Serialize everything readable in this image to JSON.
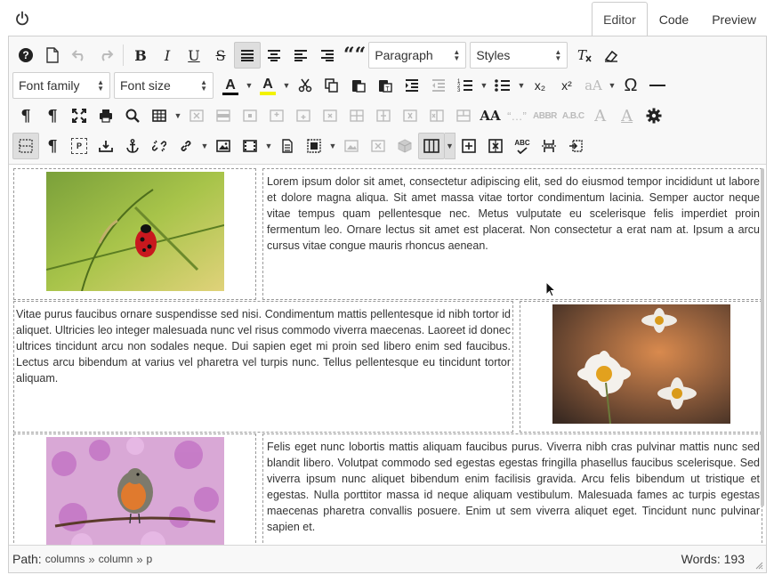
{
  "tabs": [
    {
      "label": "Editor",
      "active": true
    },
    {
      "label": "Code",
      "active": false
    },
    {
      "label": "Preview",
      "active": false
    }
  ],
  "toolbar": {
    "block_format": "Paragraph",
    "styles": "Styles",
    "font_family": "Font family",
    "font_size": "Font size",
    "bold": "B",
    "italic": "I",
    "underline": "U",
    "strikethrough": "S",
    "blockquote": "““",
    "subscript": "x₂",
    "superscript": "x²",
    "change_case": "aA",
    "omega": "Ω",
    "text_color_letter": "A",
    "bg_color_letter": "A",
    "text_color": "#000000",
    "bg_color": "#f2f200",
    "pilcrow_ltr": "¶",
    "pilcrow_rtl": "¶",
    "pilcrow": "¶",
    "p_label": "P",
    "aa_spell": "AA",
    "quote_dots": "“…”",
    "abbr": "ABBR",
    "abc": "A.B.C",
    "abc_check": "ABC",
    "font_a1": "A",
    "font_a2": "A"
  },
  "content": {
    "row1_text": "Lorem ipsum dolor sit amet, consectetur adipiscing elit, sed do eiusmod tempor incididunt ut labore et dolore magna aliqua. Sit amet massa vitae tortor condimentum lacinia. Semper auctor neque vitae tempus quam pellentesque nec. Metus vulputate eu scelerisque felis imperdiet proin fermentum leo. Ornare lectus sit amet est placerat. Non consectetur a erat nam at. Ipsum a arcu cursus vitae congue mauris rhoncus aenean.",
    "row2_text": "Vitae purus faucibus ornare suspendisse sed nisi. Condimentum mattis pellentesque id nibh tortor id aliquet. Ultricies leo integer malesuada nunc vel risus commodo viverra maecenas. Laoreet id donec ultrices tincidunt arcu non sodales neque. Dui sapien eget mi proin sed libero enim sed faucibus. Lectus arcu bibendum at varius vel pharetra vel turpis nunc. Tellus pellentesque eu tincidunt tortor aliquam.",
    "row3_text": "Felis eget nunc lobortis mattis aliquam faucibus purus. Viverra nibh cras pulvinar mattis nunc sed blandit libero. Volutpat commodo sed egestas egestas fringilla phasellus faucibus scelerisque. Sed viverra ipsum nunc aliquet bibendum enim facilisis gravida. Arcu felis bibendum ut tristique et egestas. Nulla porttitor massa id neque aliquam vestibulum. Malesuada fames ac turpis egestas maecenas pharetra convallis posuere. Enim ut sem viverra aliquet eget. Tincidunt nunc pulvinar sapien et."
  },
  "statusbar": {
    "path_label": "Path:",
    "path": [
      "columns",
      "column",
      "p"
    ],
    "separator": "»",
    "words": "Words: 193"
  }
}
